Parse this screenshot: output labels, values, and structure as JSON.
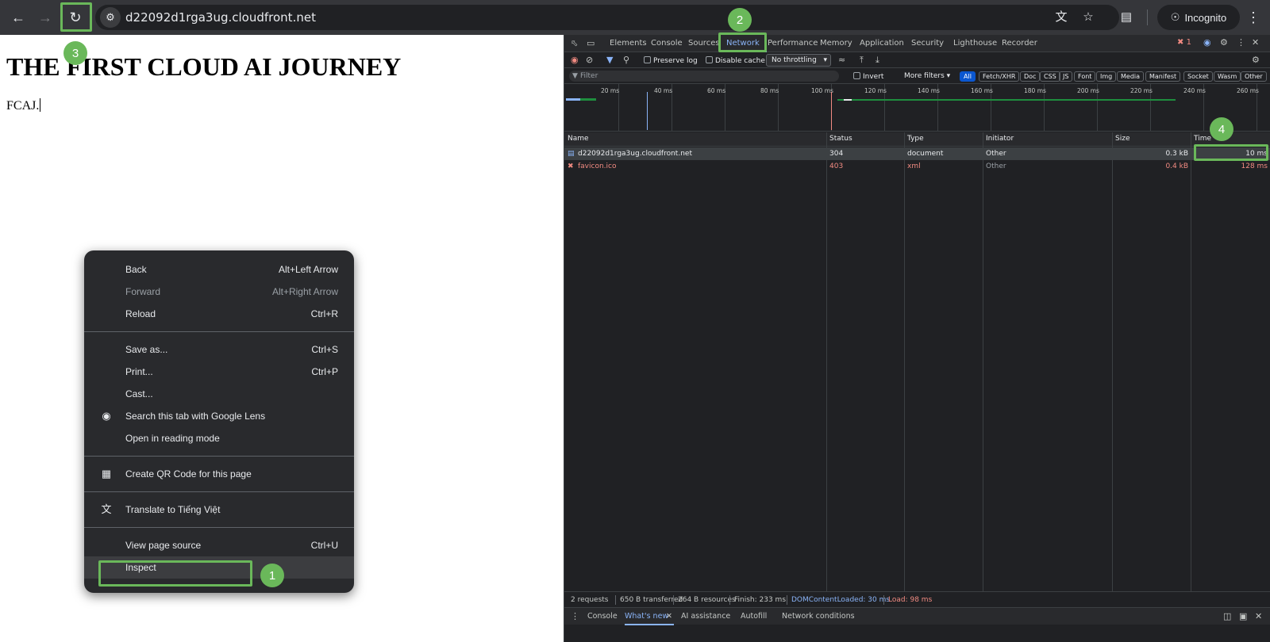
{
  "browser": {
    "url": "d22092d1rga3ug.cloudfront.net",
    "incognito_label": "Incognito"
  },
  "page": {
    "heading": "THE FIRST CLOUD AI JOURNEY",
    "text": "FCAJ."
  },
  "context_menu": {
    "items": [
      {
        "label": "Back",
        "shortcut": "Alt+Left Arrow"
      },
      {
        "label": "Forward",
        "shortcut": "Alt+Right Arrow"
      },
      {
        "label": "Reload",
        "shortcut": "Ctrl+R"
      },
      {
        "label": "Save as...",
        "shortcut": "Ctrl+S"
      },
      {
        "label": "Print...",
        "shortcut": "Ctrl+P"
      },
      {
        "label": "Cast..."
      },
      {
        "label": "Search this tab with Google Lens"
      },
      {
        "label": "Open in reading mode"
      },
      {
        "label": "Create QR Code for this page"
      },
      {
        "label": "Translate to Tiếng Việt"
      },
      {
        "label": "View page source",
        "shortcut": "Ctrl+U"
      },
      {
        "label": "Inspect"
      }
    ]
  },
  "annotations": [
    "1",
    "2",
    "3",
    "4"
  ],
  "devtools": {
    "tabs": [
      "Elements",
      "Console",
      "Sources",
      "Network",
      "Performance",
      "Memory",
      "Application",
      "Security",
      "Lighthouse",
      "Recorder"
    ],
    "error_count": "1",
    "toolbar": {
      "preserve_log": "Preserve log",
      "disable_cache": "Disable cache",
      "throttling": "No throttling"
    },
    "filter": {
      "placeholder": "Filter",
      "invert": "Invert",
      "more_filters": "More filters",
      "chips": [
        "All",
        "Fetch/XHR",
        "Doc",
        "CSS",
        "JS",
        "Font",
        "Img",
        "Media",
        "Manifest",
        "Socket",
        "Wasm",
        "Other"
      ]
    },
    "timeline_labels": [
      "20 ms",
      "40 ms",
      "60 ms",
      "80 ms",
      "100 ms",
      "120 ms",
      "140 ms",
      "160 ms",
      "180 ms",
      "200 ms",
      "220 ms",
      "240 ms",
      "260 ms"
    ],
    "columns": [
      "Name",
      "Status",
      "Type",
      "Initiator",
      "Size",
      "Time"
    ],
    "rows": [
      {
        "name": "d22092d1rga3ug.cloudfront.net",
        "status": "304",
        "type": "document",
        "initiator": "Other",
        "size": "0.3 kB",
        "time": "10 ms"
      },
      {
        "name": "favicon.ico",
        "status": "403",
        "type": "xml",
        "initiator": "Other",
        "size": "0.4 kB",
        "time": "128 ms"
      }
    ],
    "summary": [
      "2 requests",
      "650 B transferred",
      "264 B resources",
      "Finish: 233 ms",
      "DOMContentLoaded: 30 ms",
      "Load: 98 ms"
    ],
    "drawer_tabs": [
      "Console",
      "What's new",
      "AI assistance",
      "Autofill",
      "Network conditions"
    ]
  },
  "colors": {
    "annotation": "#6ab85a",
    "accent": "#8ab4f8",
    "error": "#f28b82"
  }
}
